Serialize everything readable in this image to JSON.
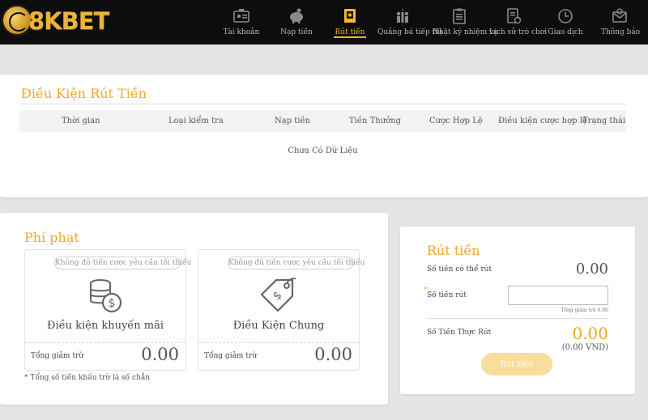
{
  "brand": {
    "logo_text": "8KBET",
    "accent": "#f0a824"
  },
  "nav": {
    "items": [
      {
        "label": "Tài khoản",
        "icon": "id-card-icon"
      },
      {
        "label": "Nạp tiền",
        "icon": "piggy-bank-icon"
      },
      {
        "label": "Rút tiền",
        "icon": "atm-withdraw-icon",
        "active": true
      },
      {
        "label": "Quảng bá tiếp thị",
        "icon": "people-promo-icon"
      },
      {
        "label": "Nhật ký nhiệm vụ",
        "icon": "clipboard-icon"
      },
      {
        "label": "Lịch sử trò chơi",
        "icon": "history-doc-icon"
      },
      {
        "label": "Giao dịch",
        "icon": "clock-icon"
      },
      {
        "label": "Thông báo",
        "icon": "mail-icon"
      }
    ]
  },
  "conditions": {
    "title": "Điều Kiện Rút Tiền",
    "columns": [
      "Thời gian",
      "Loại kiểm tra",
      "Nạp tiền",
      "Tiền Thưởng",
      "Cược Hợp Lệ",
      "Điều kiện cược hợp lệ",
      "Trạng thái"
    ],
    "empty_text": "Chưa Có Dữ Liệu"
  },
  "penalty": {
    "title": "Phí phạt",
    "cards": [
      {
        "pill": "Không đủ tiền cược yêu cầu tối thiểu",
        "name": "Điều kiện khuyến mãi",
        "total_label": "Tổng giảm trừ",
        "total_value": "0.00",
        "icon": "coins-stack-icon"
      },
      {
        "pill": "Không đủ tiền cược yêu cầu tối thiểu",
        "name": "Điều Kiện Chung",
        "total_label": "Tổng giảm trừ",
        "total_value": "0.00",
        "icon": "money-tag-icon"
      }
    ],
    "note": "* Tổng số tiền khấu trừ là số chẵn"
  },
  "withdraw": {
    "title": "Rút tiền",
    "available_label": "Số tiền có thể rút",
    "available_value": "0.00",
    "amount_label": "Số tiền rút",
    "amount_value": "",
    "deduction_hint": "Tổng giảm trừ 0.00",
    "actual_label": "Số Tiền Thực Rút",
    "actual_value": "0.00",
    "actual_vnd": "(0.00 VND)",
    "button_label": "Rút tiền"
  }
}
